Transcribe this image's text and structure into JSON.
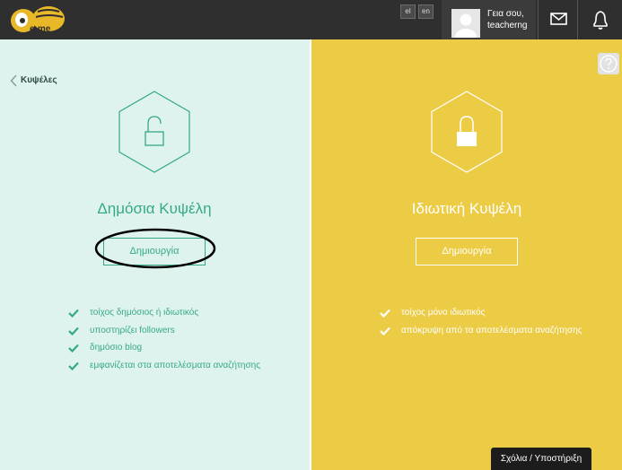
{
  "header": {
    "logo_text": "e-me",
    "languages": [
      "el",
      "en"
    ],
    "user": {
      "greeting": "Γεια σου,",
      "username": "teacherng"
    }
  },
  "nav": {
    "back_label": "Κυψέλες"
  },
  "public_hive": {
    "title": "Δημόσια Κυψέλη",
    "create_label": "Δημιουργία",
    "features": [
      "τοίχος δημόσιος ή ιδιωτικός",
      "υποστηρίζει followers",
      "δημόσιο blog",
      "εμφανίζεται στα αποτελέσματα αναζήτησης"
    ]
  },
  "private_hive": {
    "title": "Ιδιωτική Κυψέλη",
    "create_label": "Δημιουργία",
    "features": [
      "τοίχος μόνο ιδιωτικός",
      "απόκρυψη από τα αποτελέσματα αναζήτησης"
    ]
  },
  "footer": {
    "feedback_label": "Σχόλια / Υποστήριξη"
  },
  "icons": {
    "logo": "bee-logo-icon",
    "mail": "envelope-icon",
    "notifications": "bell-icon",
    "help": "question-icon",
    "back": "chevron-left-icon",
    "public": "unlocked-padlock-icon",
    "private": "locked-padlock-icon",
    "feature": "checkmark-icon"
  },
  "colors": {
    "topbar": "#2f2f2f",
    "public_bg": "#dff3ee",
    "public_accent": "#35a986",
    "private_bg": "#eccb45",
    "annotation": "#000000"
  }
}
